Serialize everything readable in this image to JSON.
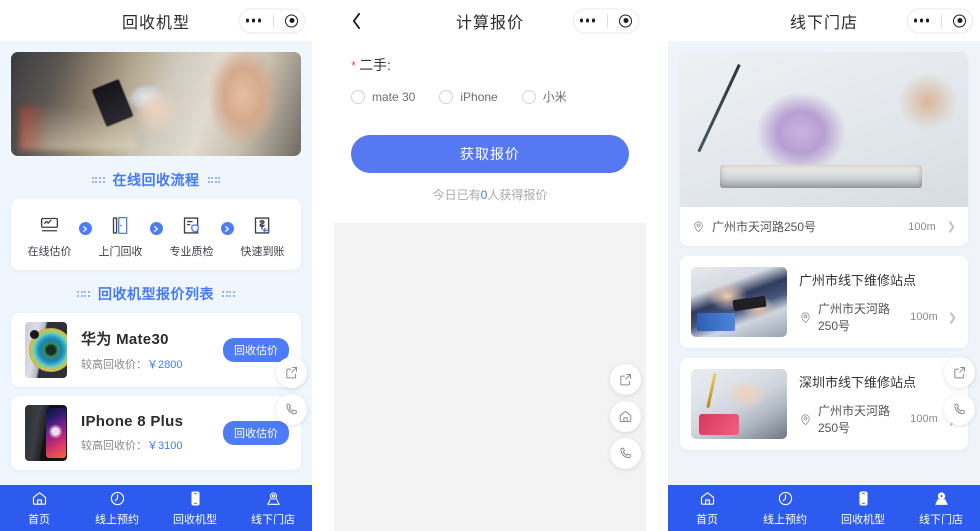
{
  "panels": [
    {
      "id": "recycle-models",
      "header": {
        "title": "回收机型",
        "has_back": false
      },
      "sections": {
        "process_title": "在线回收流程",
        "list_title": "回收机型报价列表"
      },
      "steps": [
        {
          "label": "在线估价",
          "icon": "online-valuation-icon"
        },
        {
          "label": "上门回收",
          "icon": "door-pickup-icon"
        },
        {
          "label": "专业质检",
          "icon": "quality-check-icon"
        },
        {
          "label": "快速到账",
          "icon": "fast-payment-icon"
        }
      ],
      "phones": [
        {
          "name": "华为 Mate30",
          "price_label": "较高回收价：",
          "price": "￥2800",
          "button": "回收估价"
        },
        {
          "name": "IPhone 8 Plus",
          "price_label": "较高回收价：",
          "price": "￥3100",
          "button": "回收估价"
        }
      ],
      "fabs": [
        "share-icon",
        "phone-icon"
      ]
    },
    {
      "id": "calculate-quote",
      "header": {
        "title": "计算报价",
        "has_back": true
      },
      "form": {
        "label": "二手:",
        "required_mark": "*",
        "options": [
          {
            "label": "mate 30",
            "checked": false
          },
          {
            "label": "iPhone",
            "checked": false
          },
          {
            "label": "小米",
            "checked": false
          }
        ],
        "submit": "获取报价",
        "note_prefix": "今日已有",
        "note_count": "0",
        "note_suffix": "人获得报价"
      },
      "fabs": [
        "share-icon",
        "home-icon",
        "phone-icon"
      ]
    },
    {
      "id": "offline-stores",
      "header": {
        "title": "线下门店",
        "has_back": false
      },
      "featured": {
        "address": "广州市天河路250号",
        "distance": "100m"
      },
      "stores": [
        {
          "name": "广州市线下维修站点",
          "address": "广州市天河路250号",
          "distance": "100m"
        },
        {
          "name": "深圳市线下维修站点",
          "address": "广州市天河路250号",
          "distance": "100m"
        }
      ],
      "fabs": [
        "share-icon",
        "phone-icon"
      ]
    }
  ],
  "tabbar": {
    "items": [
      {
        "label": "首页",
        "icon": "home-icon",
        "active": false
      },
      {
        "label": "线上预约",
        "icon": "clock-icon",
        "active": false
      },
      {
        "label": "回收机型",
        "icon": "mobile-icon",
        "active": false
      },
      {
        "label": "线下门店",
        "icon": "location-icon",
        "active": false
      }
    ],
    "active_index_panel3": 3
  },
  "colors": {
    "brand_blue": "#2d5bf0",
    "accent_blue": "#4679f5",
    "button_blue": "#5678f0",
    "panel1_bg": "#eff6fd",
    "panel2_bg": "#f3f3f3",
    "panel3_bg": "#f0f4fa",
    "required_red": "#f05050"
  }
}
